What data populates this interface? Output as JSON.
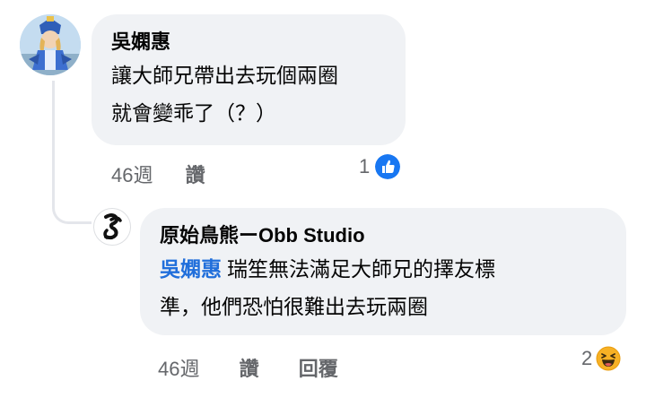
{
  "comment": {
    "author": "吳嫻惠",
    "text_line1": "讓大師兄帶出去玩個兩圈",
    "text_line2": "就會變乖了（？）",
    "time": "46週",
    "like_label": "讚",
    "reaction_count": "1",
    "reaction_icon": "like-icon"
  },
  "reply": {
    "author": "原始鳥熊ーObb Studio",
    "mention": "吳嫻惠",
    "text_line1": "瑞笙無法滿足大師兄的擇友標",
    "text_line2": "準，他們恐怕很難出去玩兩圈",
    "time": "46週",
    "like_label": "讚",
    "reply_label": "回覆",
    "reaction_count": "2",
    "reaction_icon": "haha-icon"
  },
  "colors": {
    "bubble": "#f0f2f5",
    "mention": "#216fdb",
    "meta": "#65676b",
    "like_blue": "#1877f2",
    "haha_yellow": "#f7b125"
  }
}
